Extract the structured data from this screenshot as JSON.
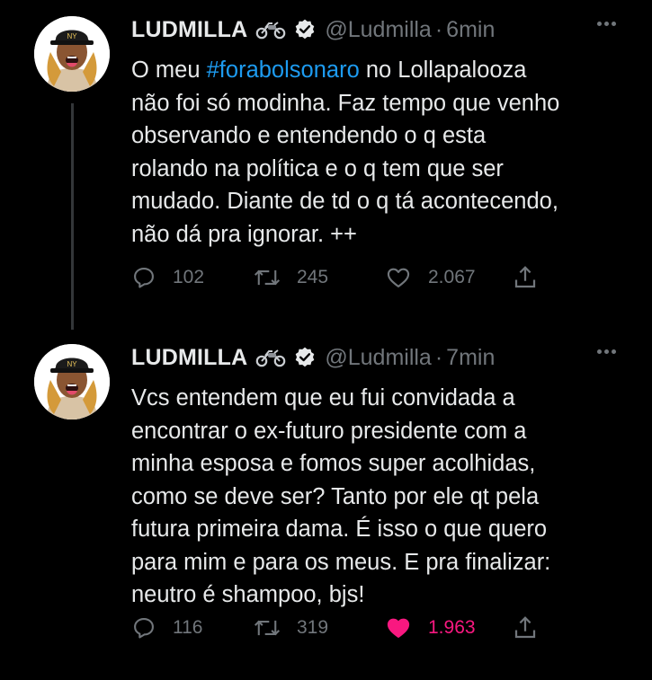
{
  "tweets": [
    {
      "name": "LUDMILLA",
      "handle": "@Ludmilla",
      "time": "6min",
      "text_before": "O meu ",
      "hashtag": "#forabolsonaro",
      "text_after": " no Lollapalooza\nnão foi só modinha. Faz tempo que venho\nobservando e entendendo o q esta\nrolando na política e o q tem que ser\nmudado. Diante de td o q tá acontecendo,\nnão dá pra ignorar. ++",
      "replies": "102",
      "retweets": "245",
      "likes": "2.067",
      "liked": false
    },
    {
      "name": "LUDMILLA",
      "handle": "@Ludmilla",
      "time": "7min",
      "text": "Vcs entendem que eu fui convidada a\nencontrar o ex-futuro presidente com a\nminha esposa e fomos super acolhidas,\ncomo se deve ser? Tanto por ele qt pela\nfutura primeira dama. É isso o que quero\npara mim e para os meus. E pra finalizar:\nneutro é shampoo, bjs!",
      "replies": "116",
      "retweets": "319",
      "likes": "1.963",
      "liked": true
    }
  ],
  "separator": "·",
  "icons": [
    "motorcycle-icon",
    "verified-icon",
    "more-icon",
    "reply-icon",
    "retweet-icon",
    "like-icon",
    "share-icon"
  ],
  "colors": {
    "background": "#000000",
    "text": "#e7e9ea",
    "muted": "#71767b",
    "link": "#1d9bf0",
    "like_active": "#f91880",
    "thread_line": "#333639"
  }
}
